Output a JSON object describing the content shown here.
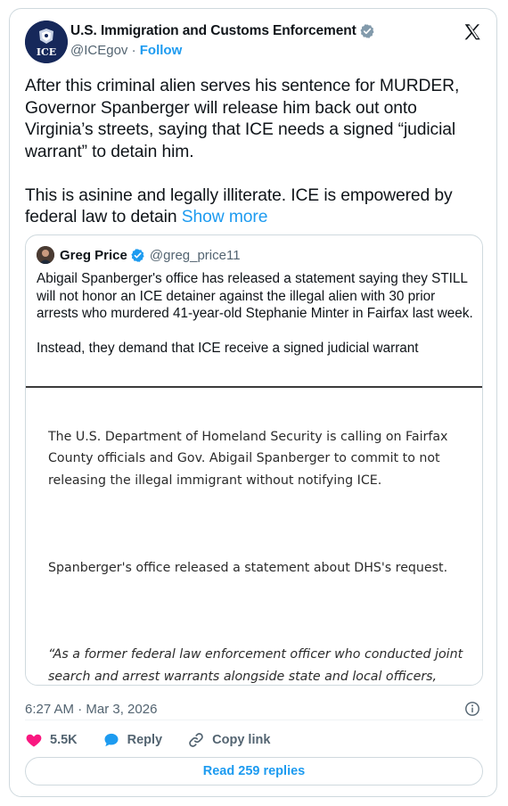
{
  "author": {
    "display_name": "U.S. Immigration and Customs Enforcement",
    "handle": "@ICEgov",
    "separator": " · ",
    "follow_label": "Follow",
    "avatar_text": "ICE"
  },
  "tweet": {
    "text": "After this criminal alien serves his sentence for MURDER, Governor Spanberger will release him back out onto Virginia’s streets, saying that ICE needs a signed “judicial warrant” to detain him.\n\nThis is asinine and legally illiterate. ICE is empowered by federal law to detain ",
    "show_more_label": "Show more",
    "timestamp": "6:27 AM · Mar 3, 2026"
  },
  "quoted": {
    "display_name": "Greg Price",
    "handle": "@greg_price11",
    "text": "Abigail Spanberger's office has released a statement saying they STILL will not honor an ICE detainer against the illegal alien with 30 prior arrests who murdered 41-year-old Stephanie Minter in Fairfax last week.\n\nInstead, they demand that ICE receive a signed judicial warrant",
    "image_article": {
      "para1": "The U.S. Department of Homeland Security is calling on Fairfax County officials and Gov. Abigail Spanberger to commit to not releasing the illegal immigrant without notifying ICE.",
      "para2": "Spanberger's office released a statement about DHS's request.",
      "para3": "“As a former federal law enforcement officer who conducted joint search and arrest warrants alongside state and local officers, Governor Spanberger firmly believes that violent criminals who are in the United States illegally should be deported by immigration enforcement. DHS should request a signed judicial warrant to ensure this violent criminal is deported.”"
    }
  },
  "actions": {
    "like_count": "5.5K",
    "reply_label": "Reply",
    "copy_link_label": "Copy link"
  },
  "read_replies_label": "Read 259 replies",
  "icons": {
    "verified": "verified-badge-icon",
    "x_logo": "x-logo-icon",
    "info": "info-icon",
    "heart": "heart-icon",
    "reply": "reply-bubble-icon",
    "link": "link-icon"
  },
  "colors": {
    "accent": "#1d9bf0",
    "like": "#f91880",
    "muted": "#536471",
    "border": "#cfd9de"
  }
}
